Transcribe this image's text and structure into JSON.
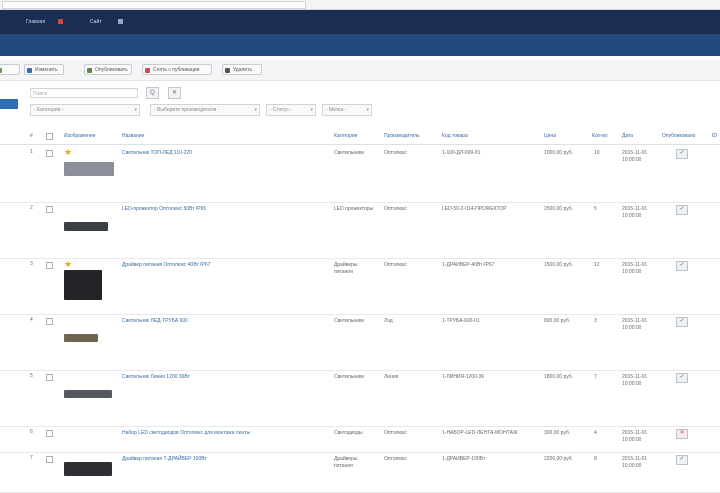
{
  "browser": {
    "url": ""
  },
  "admin_bar": {
    "items": [
      "",
      "Главная",
      "",
      "Сайт",
      "",
      ""
    ]
  },
  "toolbar": {
    "buttons": [
      {
        "label": "",
        "icon": "new-icon",
        "color": "#6a9a3a"
      },
      {
        "label": "Изменить",
        "icon": "edit-icon",
        "color": "#2f6fb5"
      },
      {
        "label": "Опубликовать",
        "icon": "publish-icon",
        "color": "#5a8a3a"
      },
      {
        "label": "Снять с публикации",
        "icon": "unpublish-icon",
        "color": "#d24a4a"
      },
      {
        "label": "Удалить",
        "icon": "delete-icon",
        "color": "#555555"
      }
    ]
  },
  "filters": {
    "search_placeholder": "Поиск",
    "search_btn": "Q",
    "clear_btn": "✕",
    "selects": [
      "- Категория -",
      "- Выберите производителя -",
      "- Статус -",
      "- Метка -"
    ]
  },
  "table": {
    "headers": [
      "#",
      "",
      "Изображение",
      "Название",
      "Категория",
      "Производитель",
      "Код товара",
      "Цена",
      "Кол-во",
      "Дата",
      "Опубликовано",
      "ID"
    ],
    "rows": [
      {
        "num": "1",
        "title": "Светильник ТОП-ЛЕД 110-220",
        "category": "Светильники",
        "maker": "Оптолюкс",
        "code": "1-100-ДЛ-009-01",
        "price": "1000,00 руб.",
        "qty": "10",
        "date": "2015-11-01 10:00:00",
        "featured": true,
        "published": true
      },
      {
        "num": "2",
        "title": "LED-прожектор Оптолюкс 50Вт IP65",
        "category": "LED прожекторы",
        "maker": "Оптолюкс",
        "code": "LED-50-2-014-ПРОЖЕКТОР",
        "price": "2500,00 руб.",
        "qty": "5",
        "date": "2015-11-01 10:00:00",
        "featured": false,
        "published": true
      },
      {
        "num": "3",
        "title": "Драйвер питания Оптолюкс 40Вт IP67",
        "category": "Драйверы питания",
        "maker": "Оптолюкс",
        "code": "1-ДРАЙВЕР-40Вт-IP67",
        "price": "1500,00 руб.",
        "qty": "12",
        "date": "2015-11-01 10:00:00",
        "featured": true,
        "published": true
      },
      {
        "num": "4",
        "title": "Светильник ЛЕД-ТРУБА 600",
        "category": "Светильники",
        "maker": "Лэд",
        "code": "1-ТРУБА-600-01",
        "price": "800,00 руб.",
        "qty": "3",
        "date": "2015-11-01 10:00:00",
        "featured": false,
        "published": true
      },
      {
        "num": "5",
        "title": "Светильник Линия 1200 36Вт",
        "category": "Светильники",
        "maker": "Линия",
        "code": "1-ЛИНИЯ-1200-36",
        "price": "1800,00 руб.",
        "qty": "7",
        "date": "2015-11-01 10:00:00",
        "featured": false,
        "published": true
      },
      {
        "num": "6",
        "title": "Набор LED светодиодов Оптолюкс для монтажа ленты",
        "category": "Светодиоды",
        "maker": "Оптолюкс",
        "code": "1-НАБОР-LED-ЛЕНТА-МОНТАЖ",
        "price": "300,00 руб.",
        "qty": "4",
        "date": "2015-11-01 10:00:00",
        "featured": false,
        "published": false
      },
      {
        "num": "7",
        "title": "Драйвер питания Т-ДРАЙВЕР 100Вт",
        "category": "Драйверы питания",
        "maker": "Оптолюкс",
        "code": "1-ДРАЙВЕР-100Вт",
        "price": "2200,00 руб.",
        "qty": "8",
        "date": "2015-11-01 10:00:00",
        "featured": false,
        "published": true
      }
    ]
  }
}
